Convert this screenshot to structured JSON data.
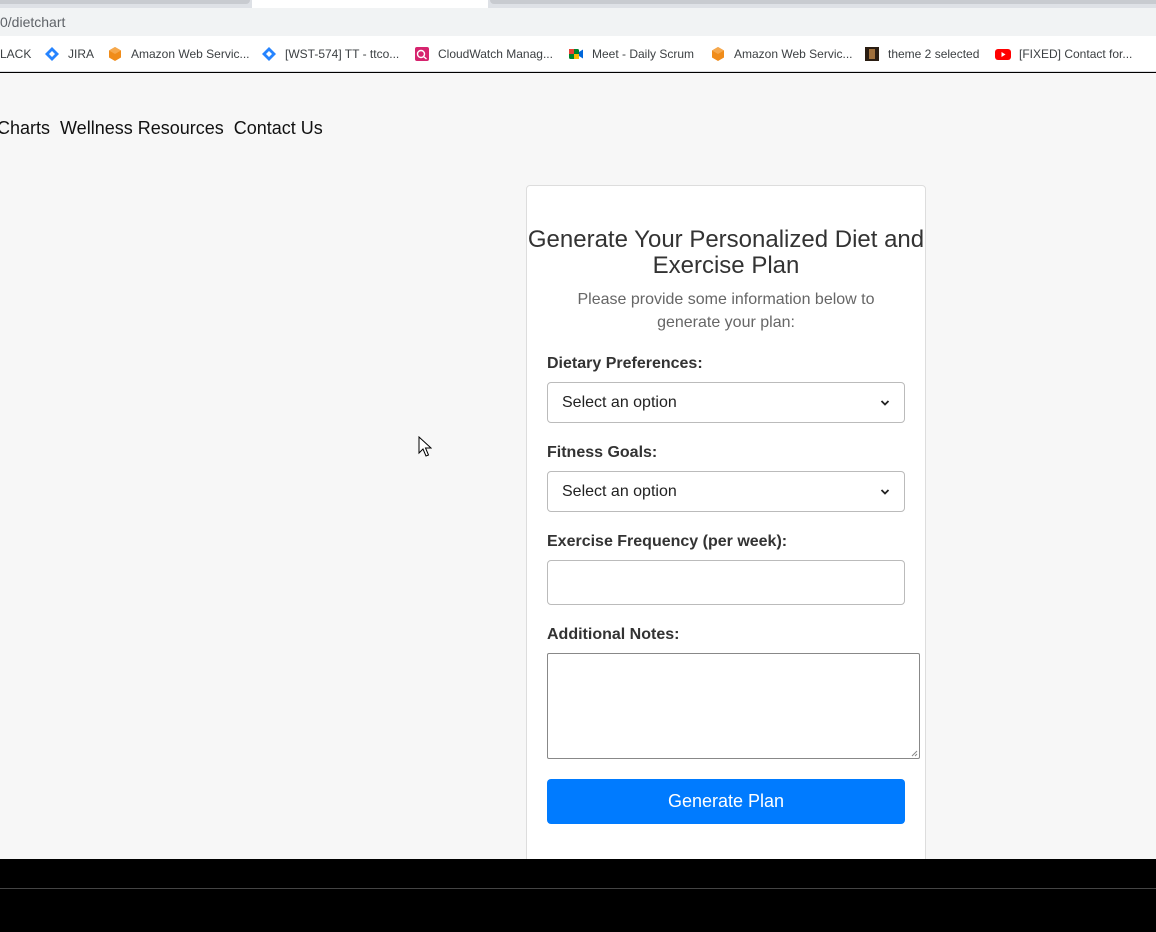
{
  "browser": {
    "url": "0/dietchart",
    "bookmarks": [
      {
        "label": "LACK",
        "icon": "none"
      },
      {
        "label": "JIRA",
        "icon": "jira-icon"
      },
      {
        "label": "Amazon Web Servic...",
        "icon": "aws-icon"
      },
      {
        "label": "[WST-574] TT - ttco...",
        "icon": "jira-icon"
      },
      {
        "label": "CloudWatch Manag...",
        "icon": "cloudwatch-icon"
      },
      {
        "label": "Meet - Daily Scrum",
        "icon": "meet-icon"
      },
      {
        "label": "Amazon Web Servic...",
        "icon": "aws-icon"
      },
      {
        "label": "theme 2 selected",
        "icon": "theme-thumbnail-icon"
      },
      {
        "label": "[FIXED] Contact for...",
        "icon": "youtube-icon"
      }
    ]
  },
  "nav": {
    "items": [
      "Charts",
      "Wellness Resources",
      "Contact Us"
    ]
  },
  "form": {
    "title": "Generate Your Personalized Diet and Exercise Plan",
    "subtitle": "Please provide some information below to generate your plan:",
    "dietary_label": "Dietary Preferences:",
    "dietary_value": "Select an option",
    "fitness_label": "Fitness Goals:",
    "fitness_value": "Select an option",
    "frequency_label": "Exercise Frequency (per week):",
    "frequency_value": "",
    "notes_label": "Additional Notes:",
    "notes_value": "",
    "submit_label": "Generate Plan"
  },
  "colors": {
    "accent": "#007bff",
    "page_bg": "#f7f7f7"
  }
}
